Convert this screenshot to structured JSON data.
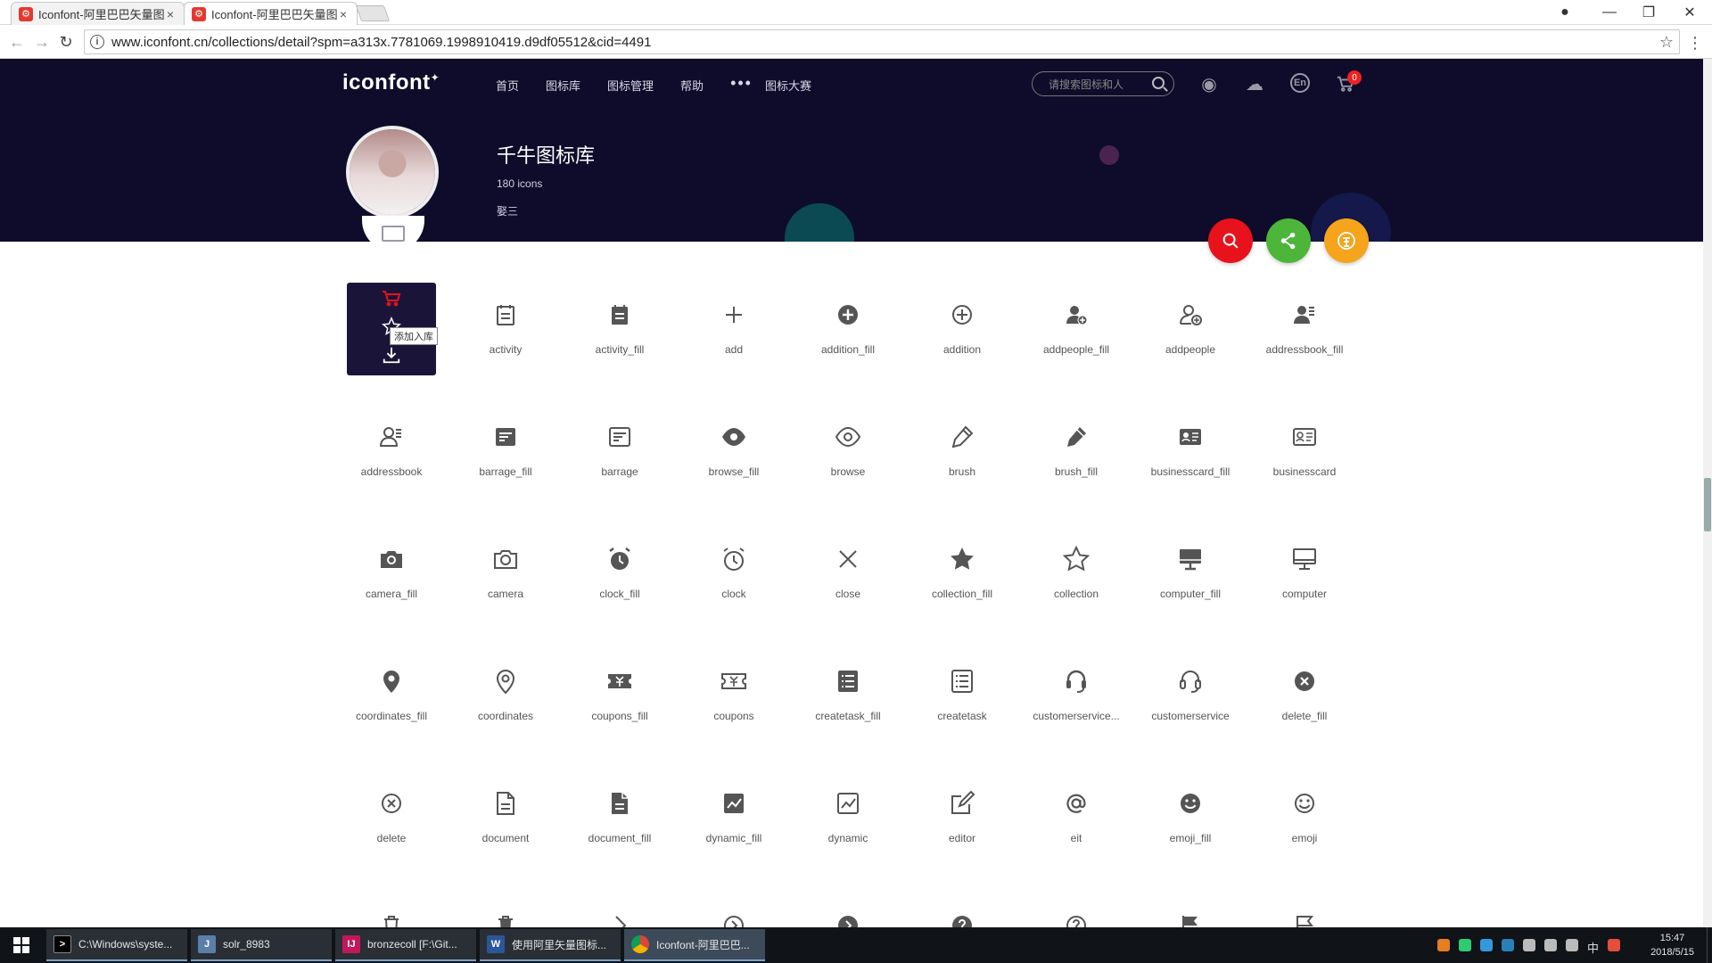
{
  "browser": {
    "tabs": [
      {
        "title": "Iconfont-阿里巴巴矢量图",
        "active": false
      },
      {
        "title": "Iconfont-阿里巴巴矢量图",
        "active": true
      }
    ],
    "url": "www.iconfont.cn/collections/detail?spm=a313x.7781069.1998910419.d9df05512&cid=4491"
  },
  "site": {
    "logo": "iconfont",
    "nav": [
      "首页",
      "图标库",
      "图标管理",
      "帮助",
      "图标大赛"
    ],
    "search_placeholder": "请搜索图标和人",
    "lang": "En",
    "cart_count": "0"
  },
  "collection": {
    "title": "千牛图标库",
    "count": "180 icons",
    "author": "娶三"
  },
  "tooltip": "添加入库",
  "icons": [
    {
      "name": "cart",
      "label": ""
    },
    {
      "name": "activity",
      "label": "activity"
    },
    {
      "name": "activity_fill",
      "label": "activity_fill"
    },
    {
      "name": "add",
      "label": "add"
    },
    {
      "name": "addition_fill",
      "label": "addition_fill"
    },
    {
      "name": "addition",
      "label": "addition"
    },
    {
      "name": "addpeople_fill",
      "label": "addpeople_fill"
    },
    {
      "name": "addpeople",
      "label": "addpeople"
    },
    {
      "name": "addressbook_fill",
      "label": "addressbook_fill"
    },
    {
      "name": "addressbook",
      "label": "addressbook"
    },
    {
      "name": "barrage_fill",
      "label": "barrage_fill"
    },
    {
      "name": "barrage",
      "label": "barrage"
    },
    {
      "name": "browse_fill",
      "label": "browse_fill"
    },
    {
      "name": "browse",
      "label": "browse"
    },
    {
      "name": "brush",
      "label": "brush"
    },
    {
      "name": "brush_fill",
      "label": "brush_fill"
    },
    {
      "name": "businesscard_fill",
      "label": "businesscard_fill"
    },
    {
      "name": "businesscard",
      "label": "businesscard"
    },
    {
      "name": "camera_fill",
      "label": "camera_fill"
    },
    {
      "name": "camera",
      "label": "camera"
    },
    {
      "name": "clock_fill",
      "label": "clock_fill"
    },
    {
      "name": "clock",
      "label": "clock"
    },
    {
      "name": "close",
      "label": "close"
    },
    {
      "name": "collection_fill",
      "label": "collection_fill"
    },
    {
      "name": "collection",
      "label": "collection"
    },
    {
      "name": "computer_fill",
      "label": "computer_fill"
    },
    {
      "name": "computer",
      "label": "computer"
    },
    {
      "name": "coordinates_fill",
      "label": "coordinates_fill"
    },
    {
      "name": "coordinates",
      "label": "coordinates"
    },
    {
      "name": "coupons_fill",
      "label": "coupons_fill"
    },
    {
      "name": "coupons",
      "label": "coupons"
    },
    {
      "name": "createtask_fill",
      "label": "createtask_fill"
    },
    {
      "name": "createtask",
      "label": "createtask"
    },
    {
      "name": "customerservice_fill",
      "label": "customerservice..."
    },
    {
      "name": "customerservice",
      "label": "customerservice"
    },
    {
      "name": "delete_fill",
      "label": "delete_fill"
    },
    {
      "name": "delete",
      "label": "delete"
    },
    {
      "name": "document",
      "label": "document"
    },
    {
      "name": "document_fill",
      "label": "document_fill"
    },
    {
      "name": "dynamic_fill",
      "label": "dynamic_fill"
    },
    {
      "name": "dynamic",
      "label": "dynamic"
    },
    {
      "name": "editor",
      "label": "editor"
    },
    {
      "name": "eit",
      "label": "eit"
    },
    {
      "name": "emoji_fill",
      "label": "emoji_fill"
    },
    {
      "name": "emoji",
      "label": "emoji"
    },
    {
      "name": "row6_1",
      "label": ""
    },
    {
      "name": "row6_2",
      "label": ""
    },
    {
      "name": "row6_3",
      "label": ""
    },
    {
      "name": "row6_4",
      "label": ""
    },
    {
      "name": "row6_5",
      "label": ""
    },
    {
      "name": "row6_6",
      "label": ""
    },
    {
      "name": "row6_7",
      "label": ""
    },
    {
      "name": "row6_8",
      "label": ""
    },
    {
      "name": "row6_9",
      "label": ""
    }
  ],
  "taskbar": {
    "tasks": [
      {
        "label": "C:\\Windows\\syste...",
        "icon": "cmd-icon"
      },
      {
        "label": "solr_8983",
        "icon": "java-icon"
      },
      {
        "label": "bronzecoll [F:\\Git...",
        "icon": "intellij-icon"
      },
      {
        "label": "使用阿里矢量图标...",
        "icon": "word-icon"
      },
      {
        "label": "Iconfont-阿里巴巴...",
        "icon": "chrome-icon"
      }
    ],
    "time": "15:47",
    "date": "2018/5/15",
    "ime": "中"
  }
}
